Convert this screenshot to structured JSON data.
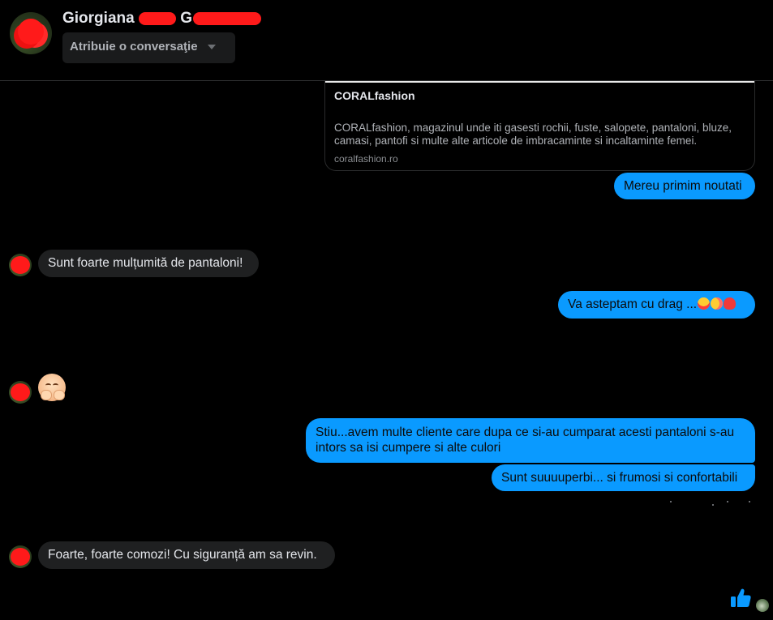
{
  "header": {
    "contact_name_visible": "Giorgiana",
    "contact_name_tail": "G",
    "assign_label": "Atribuie o conversaţie"
  },
  "link_preview": {
    "title": "CORALfashion",
    "description": "CORALfashion, magazinul unde iti gasesti rochii, fuste, salopete, pantaloni, bluze, camasi, pantofi si multe alte articole de imbracaminte si incaltaminte femei.",
    "domain": "coralfashion.ro"
  },
  "messages": [
    {
      "direction": "out",
      "text": "Mereu primim noutati"
    },
    {
      "direction": "in",
      "text": "Sunt foarte mulțumită de pantaloni!"
    },
    {
      "direction": "out",
      "text": "Va asteptam cu drag ...",
      "emojis": [
        "heart-eyes-emoji",
        "blowing-kiss-emoji",
        "red-heart-emoji"
      ]
    },
    {
      "direction": "in",
      "emoji": "smiling-face-with-open-hands-emoji"
    },
    {
      "direction": "out",
      "text": "Stiu...avem multe cliente care dupa ce si-au cumparat acesti pantaloni s-au intors sa isi cumpere si alte culori"
    },
    {
      "direction": "out",
      "text": "Sunt suuuuperbi... si frumosi si confortabili"
    },
    {
      "direction": "in",
      "text": "Foarte, foarte comozi! Cu siguranță am sa revin."
    }
  ],
  "footer": {
    "like_icon": "thumbs-up-icon"
  },
  "colors": {
    "outgoing_bubble": "#0a9aff",
    "incoming_bubble": "#1f2021",
    "background": "#000000",
    "redaction": "#ff1a1a"
  }
}
